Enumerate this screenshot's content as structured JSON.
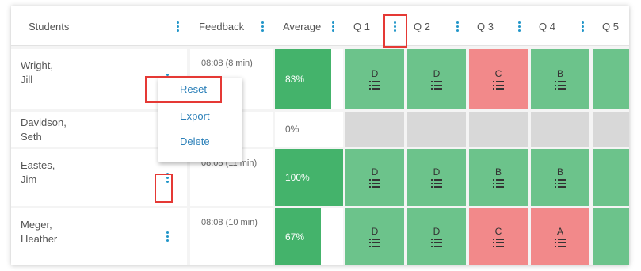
{
  "header": {
    "students": "Students",
    "feedback": "Feedback",
    "average": "Average",
    "q1": "Q 1",
    "q2": "Q 2",
    "q3": "Q 3",
    "q4": "Q 4",
    "q5": "Q 5"
  },
  "rows": [
    {
      "last": "Wright,",
      "first": "Jill",
      "feedback": "08:08 (8 min)",
      "average": "83%",
      "average_fraction": 0.83,
      "grades": [
        "D",
        "D",
        "C",
        "B"
      ],
      "grade_colors": [
        "green",
        "green",
        "red",
        "green"
      ]
    },
    {
      "last": "Davidson,",
      "first": "Seth",
      "feedback": "",
      "average": "0%",
      "average_fraction": 0,
      "grades": [
        "",
        "",
        "",
        ""
      ],
      "grade_colors": [
        "grey",
        "grey",
        "grey",
        "grey"
      ]
    },
    {
      "last": "Eastes,",
      "first": "Jim",
      "feedback": "08:08 (11 min)",
      "average": "100%",
      "average_fraction": 1.0,
      "grades": [
        "D",
        "D",
        "B",
        "B"
      ],
      "grade_colors": [
        "green",
        "green",
        "green",
        "green"
      ]
    },
    {
      "last": "Meger,",
      "first": "Heather",
      "feedback": "08:08 (10 min)",
      "average": "67%",
      "average_fraction": 0.67,
      "grades": [
        "D",
        "D",
        "C",
        "A"
      ],
      "grade_colors": [
        "green",
        "green",
        "red",
        "red"
      ]
    }
  ],
  "menu": {
    "reset": "Reset",
    "export": "Export",
    "delete": "Delete"
  },
  "colors": {
    "accent": "#2196c9",
    "average_green": "#44b36b",
    "grade_green": "#6cc38b",
    "grade_red": "#f2898a",
    "empty_grey": "#d8d8d8",
    "highlight_red": "#e53935"
  }
}
